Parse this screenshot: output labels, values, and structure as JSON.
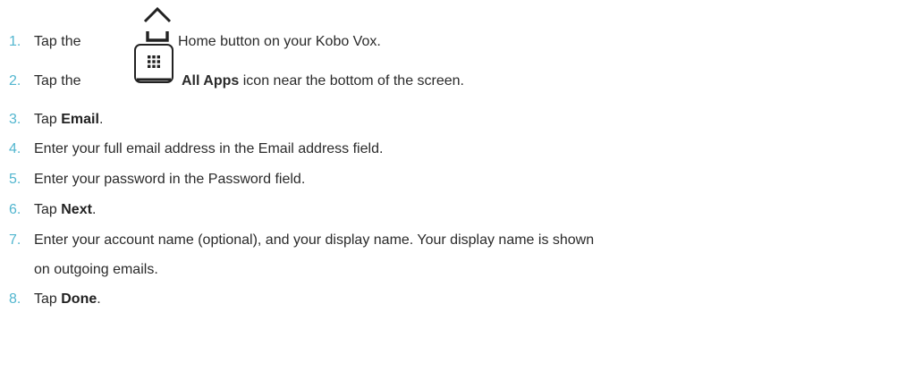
{
  "steps": [
    {
      "num": "1.",
      "pre": "Tap the",
      "icon": "home-icon",
      "post": "Home button on your Kobo Vox."
    },
    {
      "num": "2.",
      "pre": "Tap the",
      "icon": "all-apps-icon",
      "bold": "All Apps",
      "post": " icon near the bottom of the screen."
    },
    {
      "num": "3.",
      "pre": "Tap ",
      "bold": "Email",
      "post": "."
    },
    {
      "num": "4.",
      "text": "Enter your full email address in the Email address field."
    },
    {
      "num": "5.",
      "text": "Enter your password in the Password field."
    },
    {
      "num": "6.",
      "pre": "Tap ",
      "bold": "Next",
      "post": "."
    },
    {
      "num": "7.",
      "text": "Enter your account name (optional), and your display name. Your display name is shown",
      "text2": "on outgoing emails."
    },
    {
      "num": "8.",
      "pre": "Tap ",
      "bold": "Done",
      "post": "."
    }
  ],
  "colors": {
    "step_number": "#52b6cf",
    "body_text": "#2a2a2a"
  }
}
